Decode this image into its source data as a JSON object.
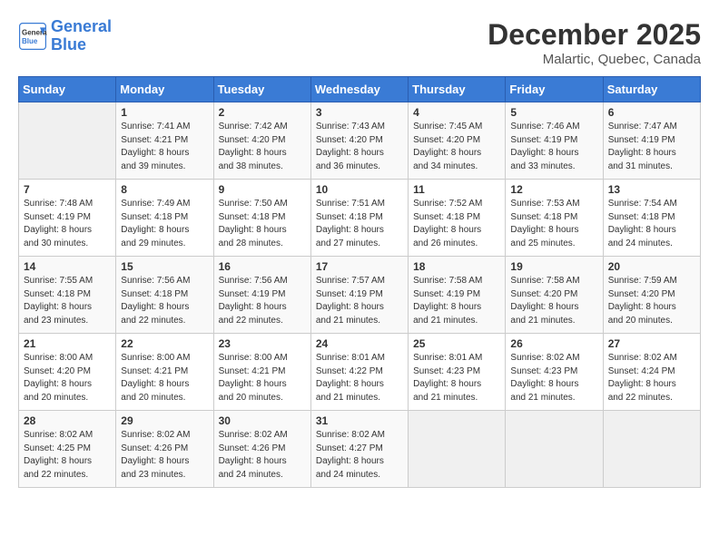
{
  "header": {
    "logo_line1": "General",
    "logo_line2": "Blue",
    "month_year": "December 2025",
    "location": "Malartic, Quebec, Canada"
  },
  "days_of_week": [
    "Sunday",
    "Monday",
    "Tuesday",
    "Wednesday",
    "Thursday",
    "Friday",
    "Saturday"
  ],
  "weeks": [
    [
      {
        "day": "",
        "empty": true
      },
      {
        "day": "1",
        "sunrise": "7:41 AM",
        "sunset": "4:21 PM",
        "daylight": "8 hours and 39 minutes."
      },
      {
        "day": "2",
        "sunrise": "7:42 AM",
        "sunset": "4:20 PM",
        "daylight": "8 hours and 38 minutes."
      },
      {
        "day": "3",
        "sunrise": "7:43 AM",
        "sunset": "4:20 PM",
        "daylight": "8 hours and 36 minutes."
      },
      {
        "day": "4",
        "sunrise": "7:45 AM",
        "sunset": "4:20 PM",
        "daylight": "8 hours and 34 minutes."
      },
      {
        "day": "5",
        "sunrise": "7:46 AM",
        "sunset": "4:19 PM",
        "daylight": "8 hours and 33 minutes."
      },
      {
        "day": "6",
        "sunrise": "7:47 AM",
        "sunset": "4:19 PM",
        "daylight": "8 hours and 31 minutes."
      }
    ],
    [
      {
        "day": "7",
        "sunrise": "7:48 AM",
        "sunset": "4:19 PM",
        "daylight": "8 hours and 30 minutes."
      },
      {
        "day": "8",
        "sunrise": "7:49 AM",
        "sunset": "4:18 PM",
        "daylight": "8 hours and 29 minutes."
      },
      {
        "day": "9",
        "sunrise": "7:50 AM",
        "sunset": "4:18 PM",
        "daylight": "8 hours and 28 minutes."
      },
      {
        "day": "10",
        "sunrise": "7:51 AM",
        "sunset": "4:18 PM",
        "daylight": "8 hours and 27 minutes."
      },
      {
        "day": "11",
        "sunrise": "7:52 AM",
        "sunset": "4:18 PM",
        "daylight": "8 hours and 26 minutes."
      },
      {
        "day": "12",
        "sunrise": "7:53 AM",
        "sunset": "4:18 PM",
        "daylight": "8 hours and 25 minutes."
      },
      {
        "day": "13",
        "sunrise": "7:54 AM",
        "sunset": "4:18 PM",
        "daylight": "8 hours and 24 minutes."
      }
    ],
    [
      {
        "day": "14",
        "sunrise": "7:55 AM",
        "sunset": "4:18 PM",
        "daylight": "8 hours and 23 minutes."
      },
      {
        "day": "15",
        "sunrise": "7:56 AM",
        "sunset": "4:18 PM",
        "daylight": "8 hours and 22 minutes."
      },
      {
        "day": "16",
        "sunrise": "7:56 AM",
        "sunset": "4:19 PM",
        "daylight": "8 hours and 22 minutes."
      },
      {
        "day": "17",
        "sunrise": "7:57 AM",
        "sunset": "4:19 PM",
        "daylight": "8 hours and 21 minutes."
      },
      {
        "day": "18",
        "sunrise": "7:58 AM",
        "sunset": "4:19 PM",
        "daylight": "8 hours and 21 minutes."
      },
      {
        "day": "19",
        "sunrise": "7:58 AM",
        "sunset": "4:20 PM",
        "daylight": "8 hours and 21 minutes."
      },
      {
        "day": "20",
        "sunrise": "7:59 AM",
        "sunset": "4:20 PM",
        "daylight": "8 hours and 20 minutes."
      }
    ],
    [
      {
        "day": "21",
        "sunrise": "8:00 AM",
        "sunset": "4:20 PM",
        "daylight": "8 hours and 20 minutes."
      },
      {
        "day": "22",
        "sunrise": "8:00 AM",
        "sunset": "4:21 PM",
        "daylight": "8 hours and 20 minutes."
      },
      {
        "day": "23",
        "sunrise": "8:00 AM",
        "sunset": "4:21 PM",
        "daylight": "8 hours and 20 minutes."
      },
      {
        "day": "24",
        "sunrise": "8:01 AM",
        "sunset": "4:22 PM",
        "daylight": "8 hours and 21 minutes."
      },
      {
        "day": "25",
        "sunrise": "8:01 AM",
        "sunset": "4:23 PM",
        "daylight": "8 hours and 21 minutes."
      },
      {
        "day": "26",
        "sunrise": "8:02 AM",
        "sunset": "4:23 PM",
        "daylight": "8 hours and 21 minutes."
      },
      {
        "day": "27",
        "sunrise": "8:02 AM",
        "sunset": "4:24 PM",
        "daylight": "8 hours and 22 minutes."
      }
    ],
    [
      {
        "day": "28",
        "sunrise": "8:02 AM",
        "sunset": "4:25 PM",
        "daylight": "8 hours and 22 minutes."
      },
      {
        "day": "29",
        "sunrise": "8:02 AM",
        "sunset": "4:26 PM",
        "daylight": "8 hours and 23 minutes."
      },
      {
        "day": "30",
        "sunrise": "8:02 AM",
        "sunset": "4:26 PM",
        "daylight": "8 hours and 24 minutes."
      },
      {
        "day": "31",
        "sunrise": "8:02 AM",
        "sunset": "4:27 PM",
        "daylight": "8 hours and 24 minutes."
      },
      {
        "day": "",
        "empty": true
      },
      {
        "day": "",
        "empty": true
      },
      {
        "day": "",
        "empty": true
      }
    ]
  ]
}
